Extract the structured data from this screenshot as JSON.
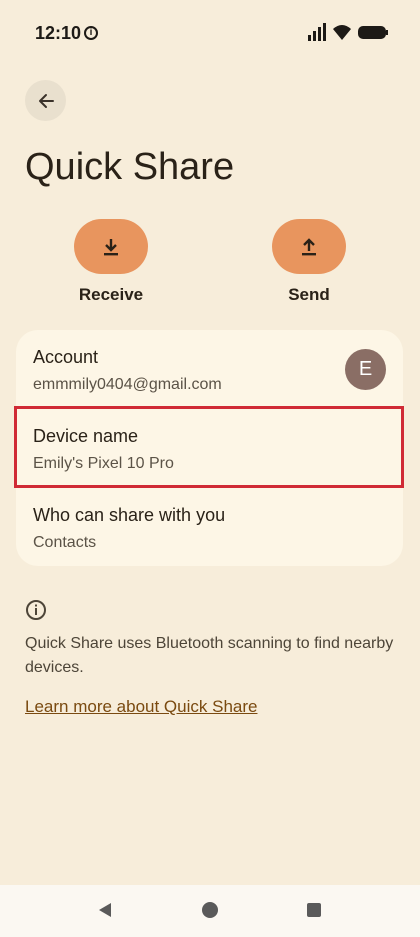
{
  "status_bar": {
    "time": "12:10"
  },
  "header": {
    "title": "Quick Share"
  },
  "actions": [
    {
      "label": "Receive"
    },
    {
      "label": "Send"
    }
  ],
  "settings": {
    "account": {
      "title": "Account",
      "value": "emmmily0404@gmail.com",
      "avatar_initial": "E"
    },
    "device_name": {
      "title": "Device name",
      "value": "Emily's Pixel 10 Pro"
    },
    "visibility": {
      "title": "Who can share with you",
      "value": "Contacts"
    }
  },
  "info": {
    "text": "Quick Share uses Bluetooth scanning to find nearby devices.",
    "link": "Learn more about Quick Share"
  },
  "colors": {
    "accent": "#e8955e",
    "highlight": "#d02a35",
    "background": "#f7edda",
    "card": "#fdf6e6"
  }
}
